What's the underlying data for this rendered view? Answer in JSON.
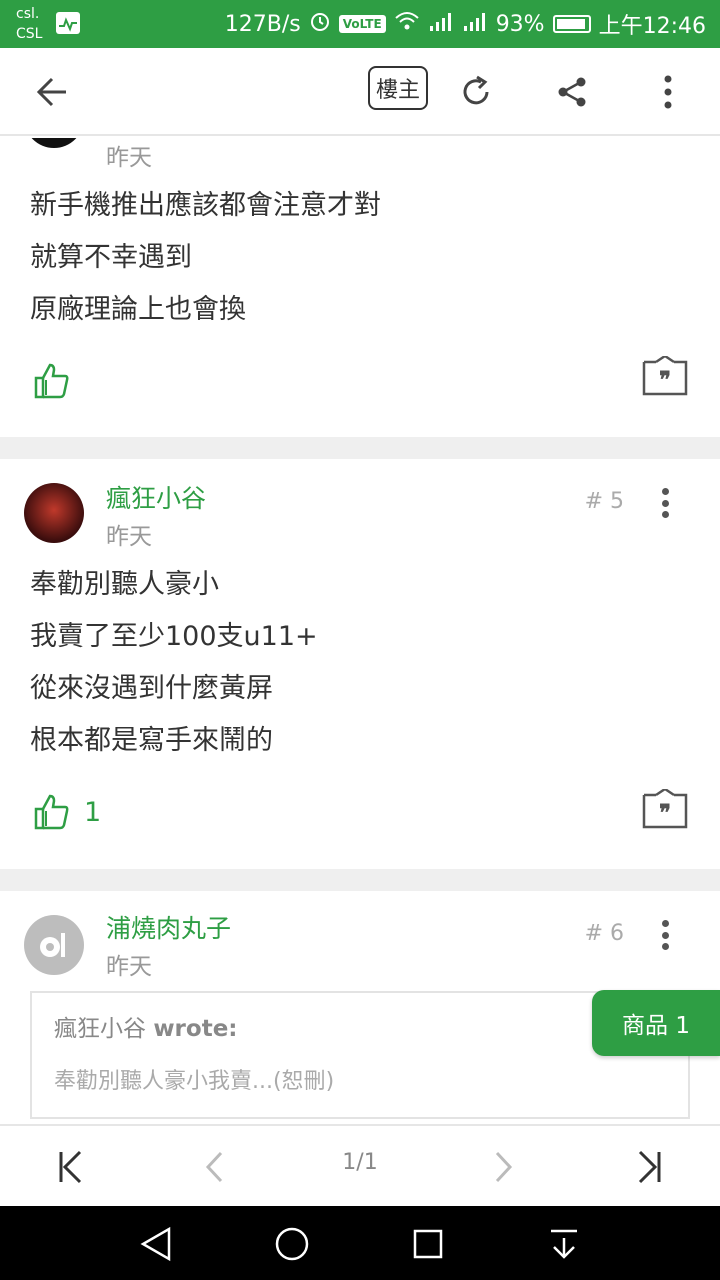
{
  "status_bar": {
    "carrier_line1": "csl.",
    "carrier_line2": "CSL",
    "speed": "127B/s",
    "volte": "VoLTE",
    "battery": "93%",
    "time": "上午12:46"
  },
  "toolbar": {
    "louzhu_label": "樓主"
  },
  "posts": [
    {
      "time": "昨天",
      "body": "新手機推出應該都會注意才對\n就算不幸遇到\n原廠理論上也會換",
      "likes": ""
    },
    {
      "username": "瘋狂小谷",
      "time": "昨天",
      "floor": "# 5",
      "body": "奉勸別聽人豪小\n我賣了至少100支u11+\n從來沒遇到什麼黃屏\n根本都是寫手來鬧的",
      "likes": "1"
    },
    {
      "username": "浦燒肉丸子",
      "time": "昨天",
      "floor": "# 6",
      "quote": {
        "author": "瘋狂小谷",
        "wrote": "wrote:",
        "text": "奉勸別聽人豪小我賣...(恕刪)"
      }
    }
  ],
  "floating_tab": "商品 1",
  "pager": {
    "page": "1/1"
  },
  "colors": {
    "accent": "#2e9e44",
    "separator": "#efefef"
  }
}
